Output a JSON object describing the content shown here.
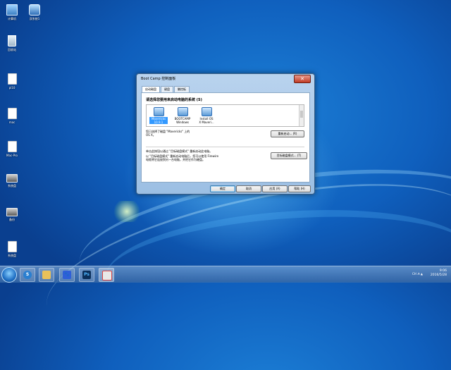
{
  "desktop": {
    "icons": [
      {
        "label": "计算机"
      },
      {
        "label": "双系统1"
      },
      {
        "label": "回收站"
      },
      {
        "label": "pl10"
      },
      {
        "label": "mac"
      },
      {
        "label": "Mac-Pro"
      },
      {
        "label": "系统盘"
      },
      {
        "label": "备份"
      },
      {
        "label": "系统盘"
      }
    ]
  },
  "dialog": {
    "title": "Boot Camp 控制面板",
    "close_label": "✕",
    "tabs": [
      {
        "label": "启动磁盘"
      },
      {
        "label": "键盘"
      },
      {
        "label": "触控板"
      }
    ],
    "heading": "请选择您要用来启动电脑的系统 (S)",
    "volumes": [
      {
        "name": "Mavericks",
        "sub": "10.9.1"
      },
      {
        "name": "BOOTCAMP",
        "sub": "Windows"
      },
      {
        "name": "Install OS",
        "sub": "X Maveri..."
      }
    ],
    "selected_info_line1": "您已选择了磁盘 \"Mavericks\" 上的",
    "selected_info_line2": "OS X。",
    "restart_button": "重新启动... (R)",
    "target_text_line1": "单击此按钮以通过 \"目标磁盘模式\" 重新启动此电脑。",
    "target_text_line2": "以 \"目标磁盘模式\" 重新启动电脑后，您可以使用 Firewire",
    "target_text_line3": "电缆将它连接到另一台电脑，并把它作为硬盘。",
    "target_button": "目标磁盘模式... (T)",
    "buttons": {
      "ok": "确定",
      "cancel": "取消",
      "apply": "应用 (A)",
      "help": "帮助 (H)"
    }
  },
  "taskbar": {
    "apps": [
      {
        "name": "sogou-icon",
        "glyph": "S",
        "color": "#2a7fd0"
      },
      {
        "name": "folder-icon",
        "glyph": "",
        "color": "#e8c15a"
      },
      {
        "name": "baidu-icon",
        "glyph": "🐾",
        "color": "#2f5fd8"
      },
      {
        "name": "photoshop-icon",
        "glyph": "Ps",
        "color": "#0b2f5a"
      },
      {
        "name": "installer-icon",
        "glyph": "",
        "color": "#d44"
      }
    ],
    "tray_label": "CH",
    "time": "9:06",
    "date": "2016/5/28"
  }
}
